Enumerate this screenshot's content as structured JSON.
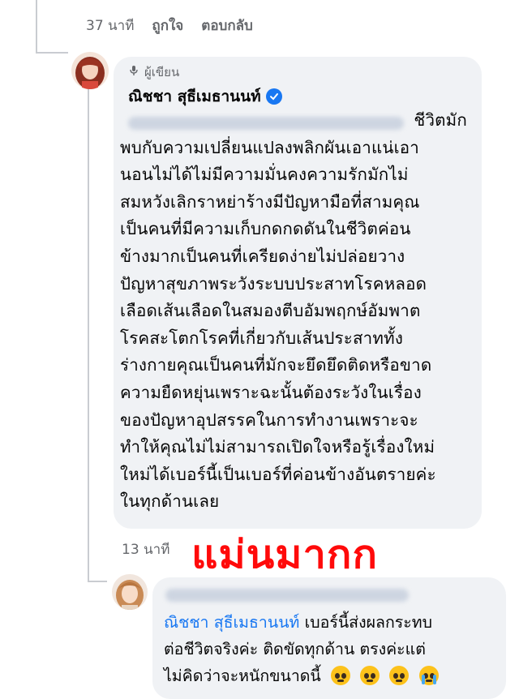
{
  "previous_comment": {
    "time": "37 นาที",
    "like_label": "ถูกใจ",
    "reply_label": "ตอบกลับ"
  },
  "main_comment": {
    "author_badge": "ผู้เขียน",
    "name": "ณิชชา สุธีเมธานนท์",
    "verified": true,
    "lines": [
      "ชีวิตมัก",
      "พบกับความเปลี่ยนแปลงพลิกผันเอาแน่เอา",
      "นอนไม่ได้ไม่มีความมั่นคงความรักมักไม่",
      "สมหวังเลิกราหย่าร้างมีปัญหามือที่สามคุณ",
      "เป็นคนที่มีความเก็บกดกดดันในชีวิตค่อน",
      "ข้างมากเป็นคนที่เครียดง่ายไม่ปล่อยวาง",
      "ปัญหาสุขภาพระวังระบบประสาทโรคหลอด",
      "เลือดเส้นเลือดในสมองตีบอัมพฤกษ์อัมพาต",
      "โรคสะโตกโรคที่เกี่ยวกับเส้นประสาททั้ง",
      "ร่างกายคุณเป็นคนที่มักจะยึดยึดติดหรือขาด",
      "ความยืดหยุ่นเพราะฉะนั้นต้องระวังในเรื่อง",
      "ของปัญหาอุปสรรคในการทำงานเพราะจะ",
      "ทำให้คุณไม่ไม่สามารถเปิดใจหรือรู้เรื่องใหม่",
      "ใหม่ได้เบอร์นี้เป็นเบอร์ที่ค่อนข้างอันตรายค่ะ",
      "ในทุกด้านเลย"
    ],
    "time": "13 นาที"
  },
  "overlay_text": "แม่นมากก",
  "reply": {
    "mention": "ณิชชา สุธีเมธานนท์",
    "text_line1": " เบอร์นี้ส่งผลกระทบ",
    "text_line2": "ต่อชีวิตจริงค่ะ ติดขัดทุกด้าน ตรงค่ะแต่",
    "text_line3": "ไม่คิดว่าจะหนักขนาดนี้"
  },
  "colors": {
    "bubble": "#f0f2f5",
    "link": "#1877f2",
    "overlay": "#ff0a0a",
    "muted": "#65676b"
  }
}
